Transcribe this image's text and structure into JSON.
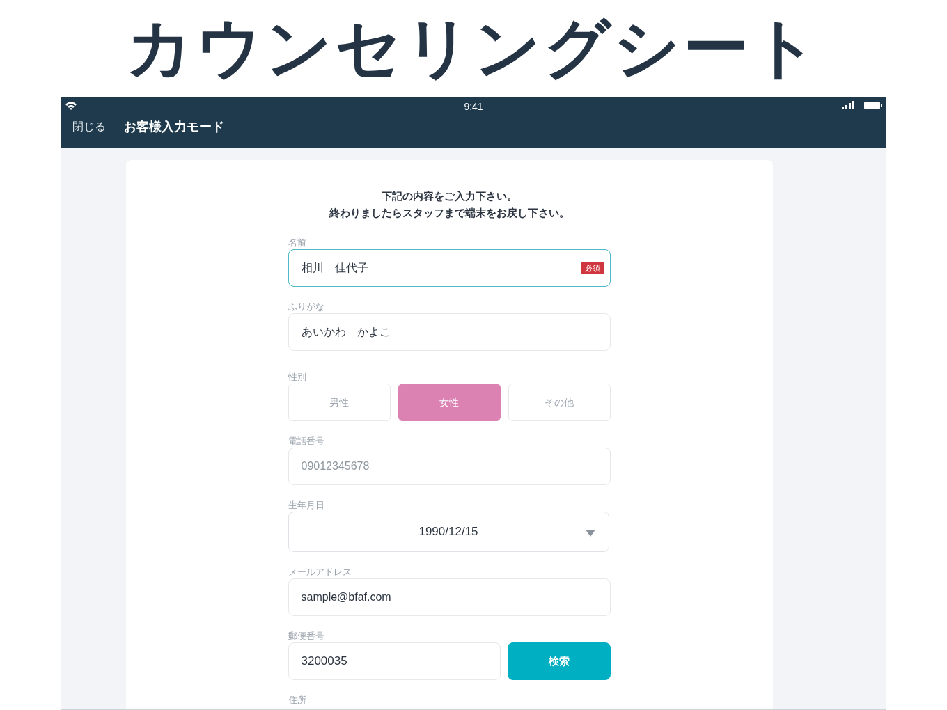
{
  "page_title": "カウンセリングシート",
  "status_bar": {
    "time": "9:41"
  },
  "nav": {
    "close": "閉じる",
    "title": "お客様入力モード"
  },
  "instructions": [
    "下記の内容をご入力下さい。",
    "終わりましたらスタッフまで端末をお戻し下さい。"
  ],
  "fields": [
    {
      "kind": "text",
      "label": "名前",
      "value": "相川　佳代子",
      "focused": true,
      "badge": "必須"
    },
    {
      "kind": "text",
      "label": "ふりがな",
      "value": "あいかわ　かよこ",
      "focused": false
    },
    {
      "kind": "choice",
      "label": "性別",
      "options": [
        {
          "label": "男性",
          "selected": false
        },
        {
          "label": "女性",
          "selected": true
        },
        {
          "label": "その他",
          "selected": false
        }
      ]
    },
    {
      "kind": "text",
      "label": "電話番号",
      "placeholder": "09012345678",
      "focused": false
    },
    {
      "kind": "select",
      "label": "生年月日",
      "value": "1990/12/15"
    },
    {
      "kind": "text",
      "label": "メールアドレス",
      "value": "sample@bfaf.com",
      "focused": false
    },
    {
      "kind": "search",
      "label": "郵便番号",
      "value": "3200035",
      "button": "検索"
    },
    {
      "kind": "label",
      "label": "住所"
    }
  ]
}
